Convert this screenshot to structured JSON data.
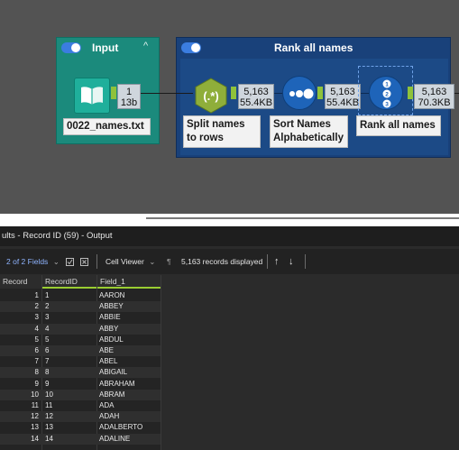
{
  "workflow": {
    "input_container": {
      "title": "Input",
      "collapse_glyph": "^",
      "tool_label": "0022_names.txt",
      "badge_records": "1",
      "badge_size": "13b"
    },
    "rank_container": {
      "title": "Rank all names",
      "tools": [
        {
          "label": "Split names to rows",
          "icon": "regex-icon",
          "glyph": "(.*)",
          "badge_records": "5,163",
          "badge_size": "55.4KB"
        },
        {
          "label": "Sort Names Alphabetically",
          "icon": "sort-icon",
          "badge_records": "5,163",
          "badge_size": "55.4KB"
        },
        {
          "label": "Rank all names",
          "icon": "record-id-icon",
          "badge_records": "5,163",
          "badge_size": "70.3KB"
        }
      ]
    },
    "colors": {
      "input_container": "#1b8a7c",
      "rank_container": "#19417a",
      "anchor": "#8fc23b",
      "toggle": "#3b7de0"
    }
  },
  "results": {
    "title_prefix": "ults",
    "title_rest": " - Record ID (59) - Output",
    "fields_selector": "2 of 2 Fields",
    "cell_viewer": "Cell Viewer",
    "records_displayed": "5,163 records displayed",
    "columns": [
      "Record",
      "RecordID",
      "Field_1"
    ],
    "rows": [
      [
        "1",
        "1",
        "AARON"
      ],
      [
        "2",
        "2",
        "ABBEY"
      ],
      [
        "3",
        "3",
        "ABBIE"
      ],
      [
        "4",
        "4",
        "ABBY"
      ],
      [
        "5",
        "5",
        "ABDUL"
      ],
      [
        "6",
        "6",
        "ABE"
      ],
      [
        "7",
        "7",
        "ABEL"
      ],
      [
        "8",
        "8",
        "ABIGAIL"
      ],
      [
        "9",
        "9",
        "ABRAHAM"
      ],
      [
        "10",
        "10",
        "ABRAM"
      ],
      [
        "11",
        "11",
        "ADA"
      ],
      [
        "12",
        "12",
        "ADAH"
      ],
      [
        "13",
        "13",
        "ADALBERTO"
      ],
      [
        "14",
        "14",
        "ADALINE"
      ]
    ]
  }
}
